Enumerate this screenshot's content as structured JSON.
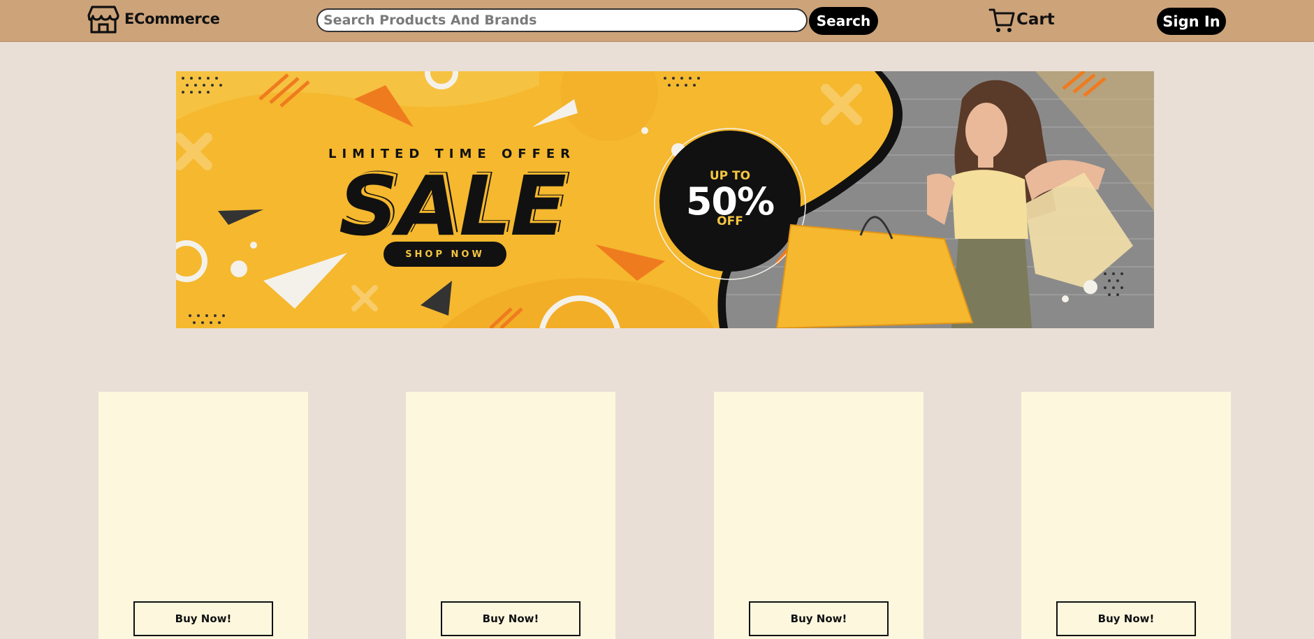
{
  "header": {
    "brand_name": "ECommerce",
    "brand_icon": "storefront-icon",
    "search_placeholder": "Search Products And Brands",
    "search_value": "",
    "search_button_label": "Search",
    "cart_label": "Cart",
    "cart_icon": "shopping-cart-icon",
    "signin_label": "Sign In"
  },
  "banner": {
    "offer_line": "LIMITED TIME OFFER",
    "headline": "SALE",
    "cta_label": "SHOP NOW",
    "promo_top": "UP TO",
    "promo_value": "50%",
    "promo_bottom": "OFF"
  },
  "products": [
    {
      "buy_label": "Buy Now!"
    },
    {
      "buy_label": "Buy Now!"
    },
    {
      "buy_label": "Buy Now!"
    },
    {
      "buy_label": "Buy Now!"
    }
  ],
  "colors": {
    "header_bg": "#cda37a",
    "page_bg": "#e9dfd6",
    "card_bg": "#fdf7de",
    "banner_yellow": "#f5b82e",
    "button_black": "#000000"
  }
}
